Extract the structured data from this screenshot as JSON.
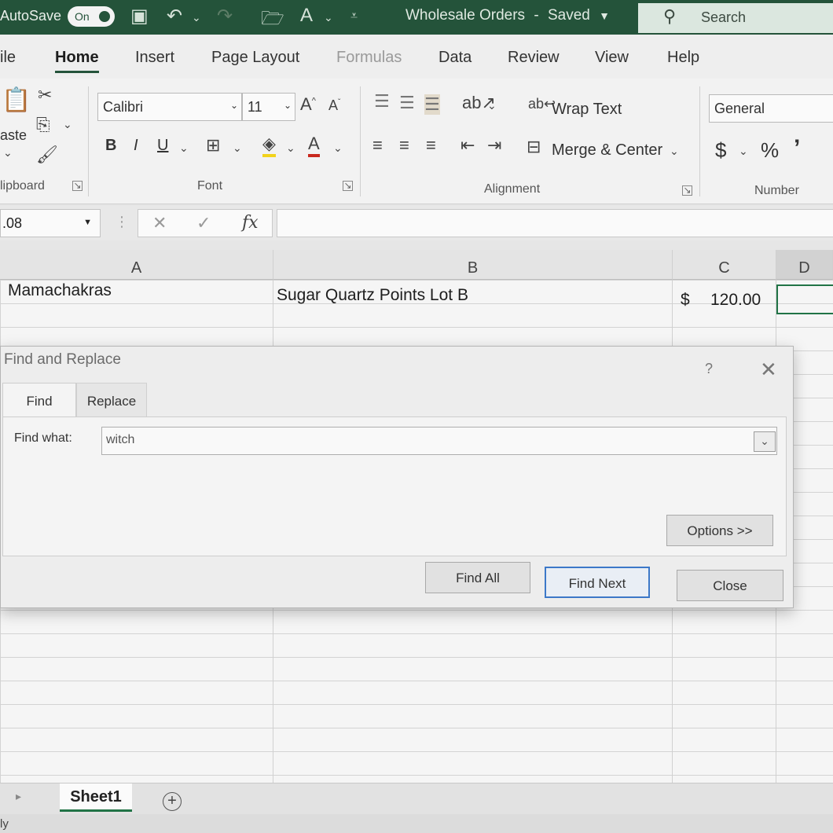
{
  "titlebar": {
    "autosave_label": "AutoSave",
    "autosave_state": "On",
    "document_title": "Wholesale Orders",
    "document_status": "Saved",
    "title_separator": "-",
    "search_label": "Search"
  },
  "tabs": [
    "ile",
    "Home",
    "Insert",
    "Page Layout",
    "Formulas",
    "Data",
    "Review",
    "View",
    "Help"
  ],
  "ribbon": {
    "clipboard": {
      "paste_label": "aste",
      "group_label": "lipboard"
    },
    "font": {
      "family": "Calibri",
      "size": "11",
      "bold": "B",
      "italic": "I",
      "underline": "U",
      "group_label": "Font"
    },
    "alignment": {
      "wrap_text": "Wrap Text",
      "merge_center": "Merge & Center",
      "group_label": "Alignment"
    },
    "number": {
      "format": "General",
      "currency": "$",
      "percent": "%",
      "comma": "’",
      "group_label": "Number"
    }
  },
  "formula_bar": {
    "name_box": ".08",
    "fx_label": "fx",
    "cancel": "✕",
    "enter": "✓",
    "formula": ""
  },
  "grid": {
    "columns": [
      "A",
      "B",
      "C",
      "D"
    ],
    "row1": {
      "a": "Mamachakras",
      "b": "Sugar Quartz Points Lot B",
      "c_currency": "$",
      "c_value": "120.00"
    }
  },
  "dialog": {
    "title": "Find and Replace",
    "help": "?",
    "tabs": [
      "Find",
      "Replace"
    ],
    "find_what_label": "Find what:",
    "find_what_value": "witch",
    "options_button": "Options >>",
    "find_all_button": "Find All",
    "find_next_button": "Find Next",
    "close_button": "Close"
  },
  "sheet": {
    "active_tab": "Sheet1",
    "add_sheet": "+"
  },
  "status": {
    "text": "ly"
  }
}
